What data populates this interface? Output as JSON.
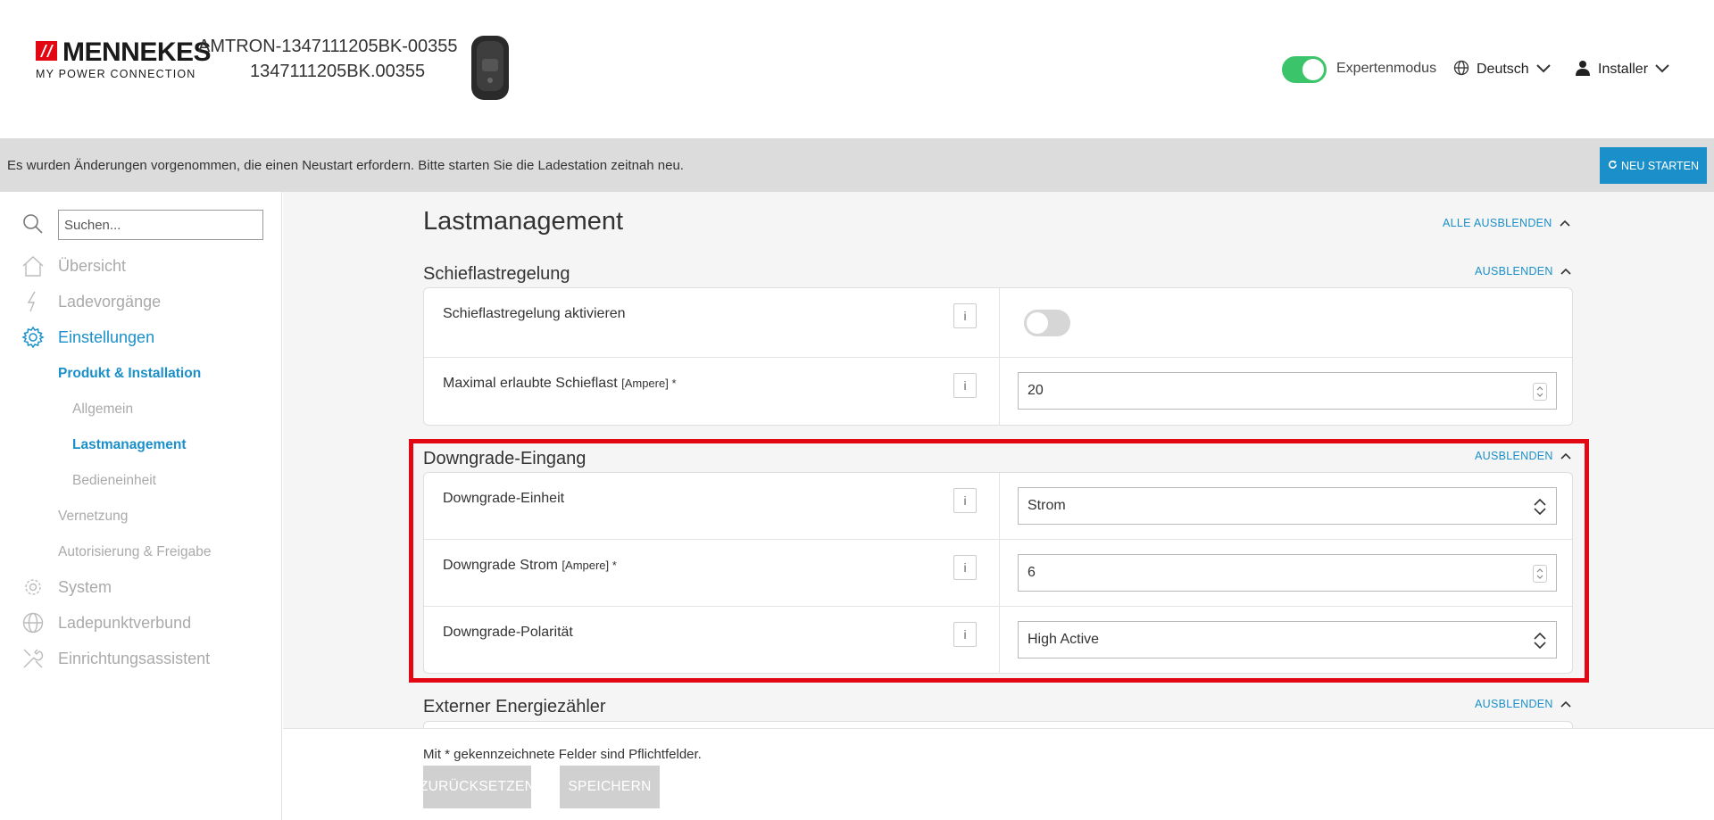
{
  "header": {
    "brand": "MENNEKES",
    "tagline": "MY POWER CONNECTION",
    "device_name": "AMTRON-1347111205BK-00355",
    "device_id": "1347111205BK.00355",
    "expert_mode_label": "Expertenmodus",
    "expert_mode_on": true,
    "language": "Deutsch",
    "user": "Installer"
  },
  "notice": {
    "text": "Es wurden Änderungen vorgenommen, die einen Neustart erfordern. Bitte starten Sie die Ladestation zeitnah neu.",
    "restart_label": "NEU STARTEN"
  },
  "sidebar": {
    "search_placeholder": "Suchen...",
    "items": [
      {
        "label": "Übersicht",
        "icon": "home-icon"
      },
      {
        "label": "Ladevorgänge",
        "icon": "lightning-icon"
      },
      {
        "label": "Einstellungen",
        "icon": "gear-icon"
      },
      {
        "label": "System",
        "icon": "system-icon"
      },
      {
        "label": "Ladepunktverbund",
        "icon": "globe-icon"
      },
      {
        "label": "Einrichtungsassistent",
        "icon": "tools-icon"
      }
    ],
    "sub_items": [
      "Produkt & Installation",
      "Vernetzung",
      "Autorisierung & Freigabe"
    ],
    "subsub_items": [
      "Allgemein",
      "Lastmanagement",
      "Bedieneinheit"
    ]
  },
  "main": {
    "title": "Lastmanagement",
    "hide_all": "ALLE AUSBLENDEN",
    "hide": "AUSBLENDEN",
    "sections": [
      {
        "title": "Schieflastregelung",
        "rows": [
          {
            "label": "Schieflastregelung aktivieren",
            "unit": "",
            "type": "toggle",
            "value": "off"
          },
          {
            "label": "Maximal erlaubte Schieflast",
            "unit": "[Ampere] *",
            "type": "number",
            "value": "20"
          }
        ]
      },
      {
        "title": "Downgrade-Eingang",
        "rows": [
          {
            "label": "Downgrade-Einheit",
            "unit": "",
            "type": "select",
            "value": "Strom"
          },
          {
            "label": "Downgrade Strom",
            "unit": "[Ampere] *",
            "type": "number",
            "value": "6"
          },
          {
            "label": "Downgrade-Polarität",
            "unit": "",
            "type": "select",
            "value": "High Active"
          }
        ]
      },
      {
        "title": "Externer Energiezähler",
        "rows": []
      }
    ]
  },
  "footer": {
    "note": "Mit * gekennzeichnete Felder sind Pflichtfelder.",
    "reset_label": "ZURÜCKSETZEN",
    "save_label": "SPEICHERN"
  },
  "colors": {
    "accent": "#1a8fc9",
    "brand_red": "#e30613",
    "toggle_on": "#3cc46a",
    "highlight": "#e30613"
  }
}
